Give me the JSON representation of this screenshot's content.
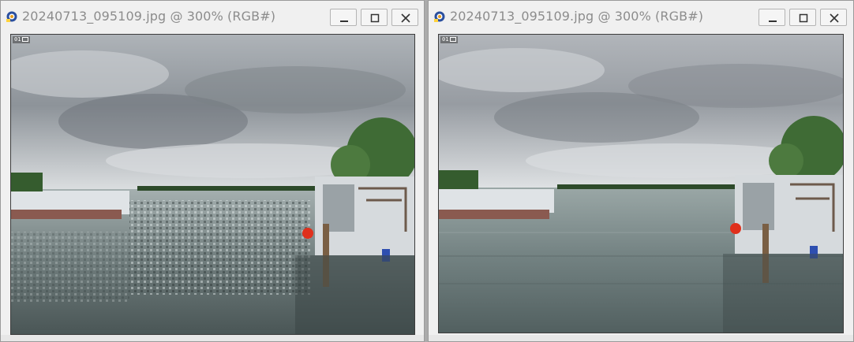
{
  "windows": [
    {
      "title": "20240713_095109.jpg @ 300% (RGB#)",
      "layer_label": "01",
      "buttons": {
        "minimize": "minimize",
        "maximize": "maximize",
        "close": "close"
      }
    },
    {
      "title": "20240713_095109.jpg @ 300% (RGB#)",
      "layer_label": "01",
      "buttons": {
        "minimize": "minimize",
        "maximize": "maximize",
        "close": "close"
      }
    }
  ],
  "colors": {
    "sky": "#c3c7cb",
    "water": "#7f8c8c",
    "trees": "#3f6b35",
    "buoy": "#e0301c",
    "title_text": "#8c8c8c"
  }
}
